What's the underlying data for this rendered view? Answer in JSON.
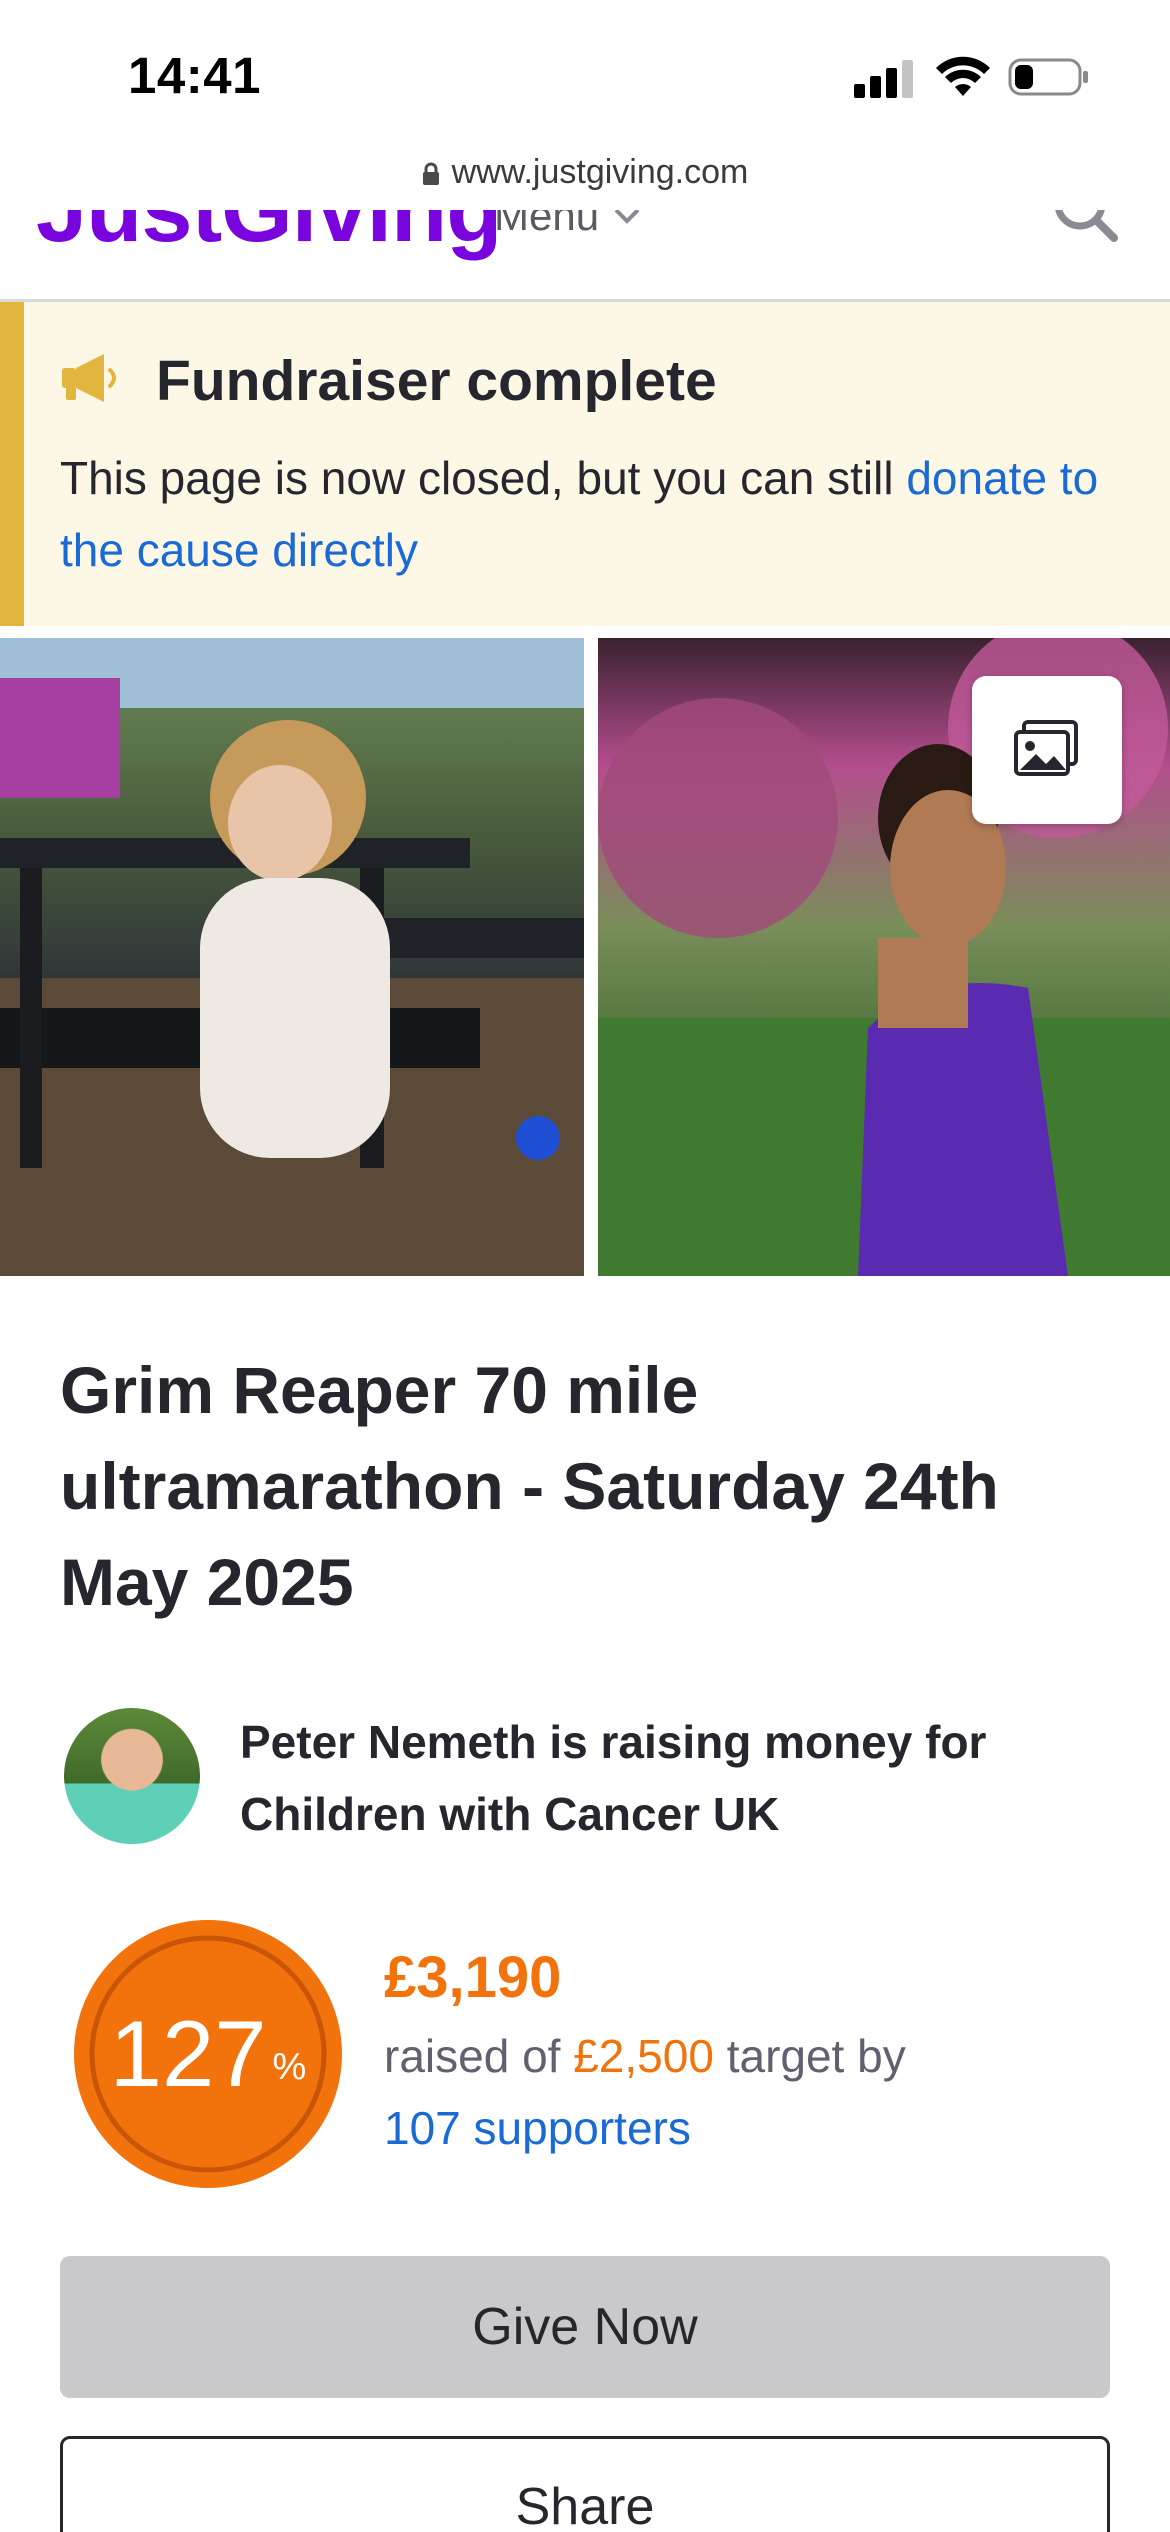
{
  "status_bar": {
    "time": "14:41"
  },
  "browser": {
    "url": "www.justgiving.com"
  },
  "header": {
    "logo_text": "JustGiving",
    "menu_label": "Menu"
  },
  "banner": {
    "title": "Fundraiser complete",
    "text": "This page is now closed, but you can still ",
    "link_text": "donate to the cause directly"
  },
  "page": {
    "title": "Grim Reaper 70 mile ultramarathon - Saturday 24th May 2025",
    "fundraiser_text": "Peter Nemeth is raising money for Children with Cancer UK"
  },
  "progress": {
    "percent": "127",
    "percent_sign": "%",
    "raised": "£3,190",
    "raised_of_prefix": "raised of ",
    "target": "£2,500",
    "target_suffix": " target by",
    "supporters": "107 supporters"
  },
  "actions": {
    "give_now_label": "Give Now",
    "share_label": "Share"
  },
  "colors": {
    "brand_purple": "#7a04dd",
    "banner_bg": "#fdf7e6",
    "banner_accent": "#e2b53e",
    "progress_orange": "#f2720c",
    "link_blue": "#1a6ad6"
  }
}
